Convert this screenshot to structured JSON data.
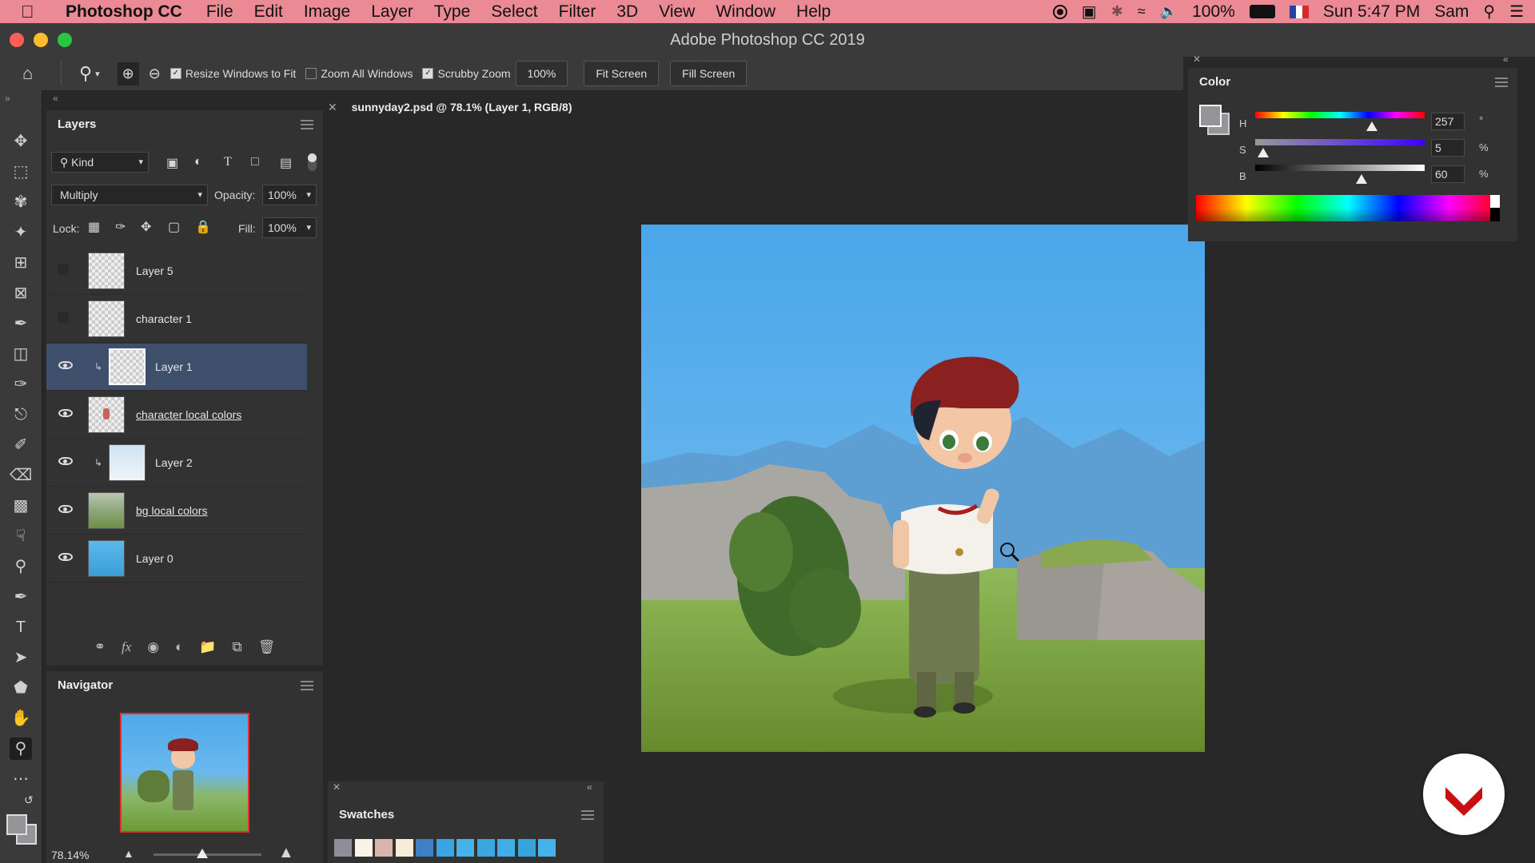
{
  "menubar": {
    "app": "Photoshop CC",
    "items": [
      "File",
      "Edit",
      "Image",
      "Layer",
      "Type",
      "Select",
      "Filter",
      "3D",
      "View",
      "Window",
      "Help"
    ],
    "battery": "100%",
    "clock": "Sun 5:47 PM",
    "user": "Sam"
  },
  "window": {
    "title": "Adobe Photoshop CC 2019"
  },
  "options": {
    "resize_windows": "Resize Windows to Fit",
    "zoom_all": "Zoom All Windows",
    "scrubby_zoom": "Scrubby Zoom",
    "zoom_value": "100%",
    "fit_screen": "Fit Screen",
    "fill_screen": "Fill Screen"
  },
  "document": {
    "tab": "sunnyday2.psd @ 78.1% (Layer 1, RGB/8)"
  },
  "layers_panel": {
    "title": "Layers",
    "kind": "Kind",
    "blend_mode": "Multiply",
    "opacity_label": "Opacity:",
    "opacity": "100%",
    "lock_label": "Lock:",
    "fill_label": "Fill:",
    "fill": "100%",
    "layers": [
      {
        "name": "Layer 5",
        "visible": false
      },
      {
        "name": "character 1",
        "visible": false
      },
      {
        "name": "Layer 1",
        "visible": true,
        "selected": true
      },
      {
        "name": "character local colors",
        "visible": true
      },
      {
        "name": "Layer 2",
        "visible": true
      },
      {
        "name": "bg local colors",
        "visible": true
      },
      {
        "name": "Layer 0",
        "visible": true
      }
    ]
  },
  "navigator": {
    "title": "Navigator",
    "zoom": "78.14%"
  },
  "color_panel": {
    "title": "Color",
    "h_label": "H",
    "h": "257",
    "h_unit": "°",
    "s_label": "S",
    "s": "5",
    "s_unit": "%",
    "b_label": "B",
    "b": "60",
    "b_unit": "%"
  },
  "swatches": {
    "title": "Swatches",
    "colors": [
      "#8e8e98",
      "#fbf3e6",
      "#d8b6ac",
      "#f7ecd8",
      "#3f7fc6",
      "#3aa4e4",
      "#45b3ea",
      "#3aa7e0",
      "#40ade6",
      "#38a4de",
      "#46b2ea"
    ]
  }
}
